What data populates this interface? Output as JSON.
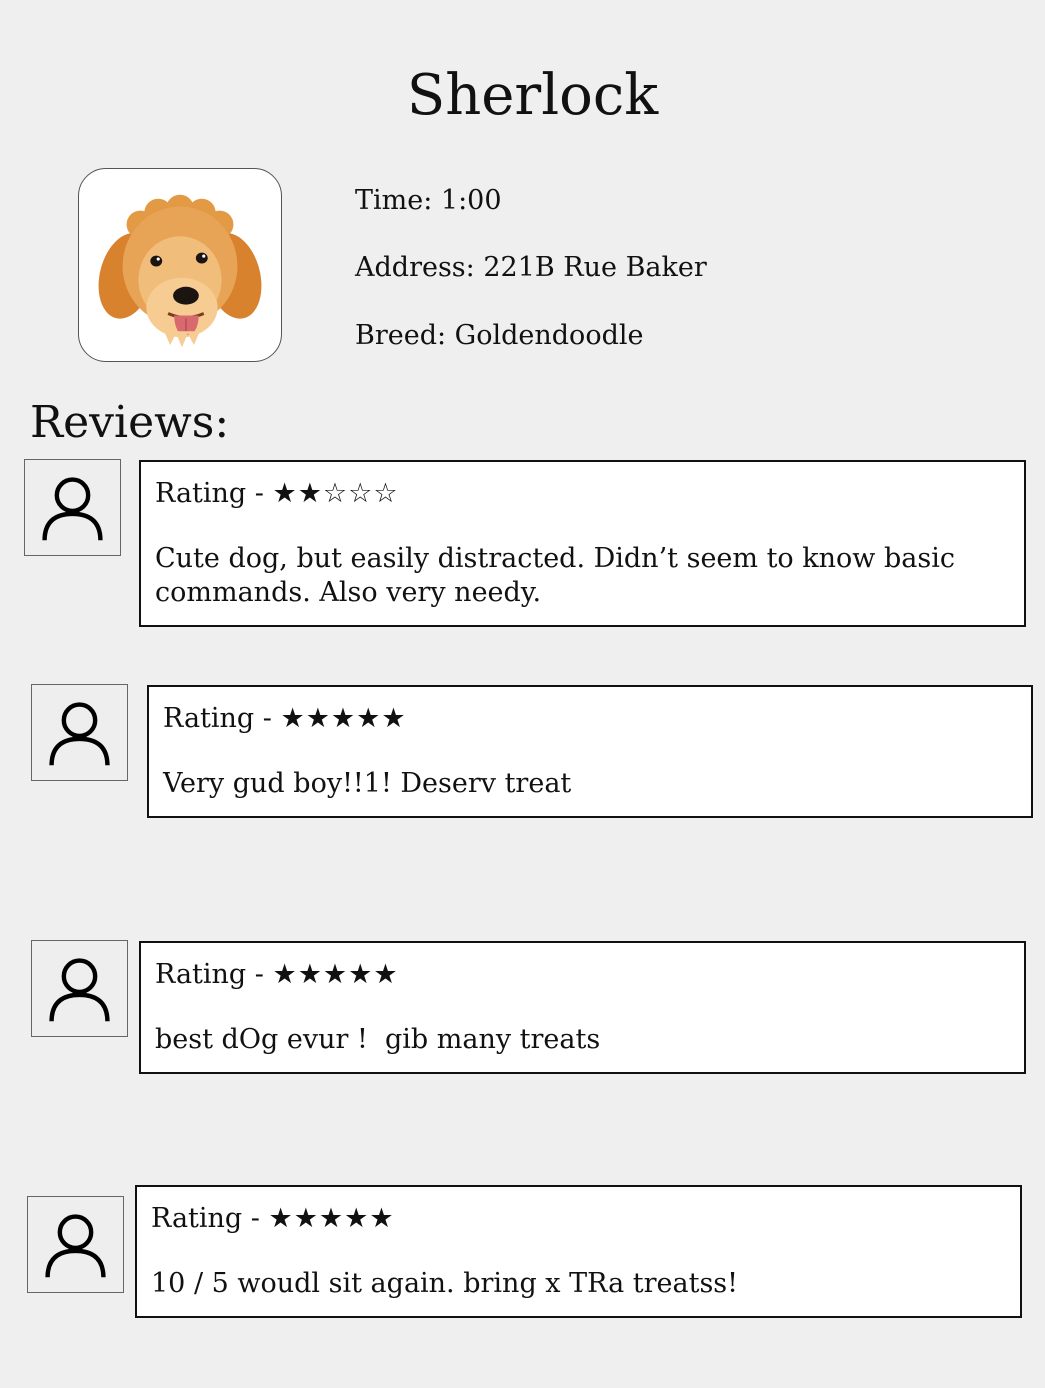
{
  "page": {
    "title": "Sherlock"
  },
  "details": {
    "time": "Time: 1:00",
    "address": "Address: 221B Rue Baker",
    "breed": "Breed: Goldendoodle"
  },
  "reviews_heading": "Reviews:",
  "reviews": [
    {
      "rating_label": "Rating -",
      "stars": "★★☆☆☆",
      "rating": 2,
      "text": "Cute dog, but easily distracted. Didn’t seem to know basic commands. Also very needy."
    },
    {
      "rating_label": "Rating -",
      "stars": "★★★★★",
      "rating": 5,
      "text": "Very gud boy!!1! Deserv treat"
    },
    {
      "rating_label": "Rating -",
      "stars": "★★★★★",
      "rating": 5,
      "text": "best dOg evur !  gib many treats"
    },
    {
      "rating_label": "Rating -",
      "stars": "★★★★★",
      "rating": 5,
      "text": "10 / 5 woudl sit again. bring x TRa treatss!"
    }
  ],
  "icons": {
    "dog_photo": "goldendoodle-face-icon",
    "avatar": "user-avatar-icon"
  },
  "colors": {
    "background": "#efefef",
    "card_background": "#ffffff",
    "dog_fur": "#e0913a"
  }
}
